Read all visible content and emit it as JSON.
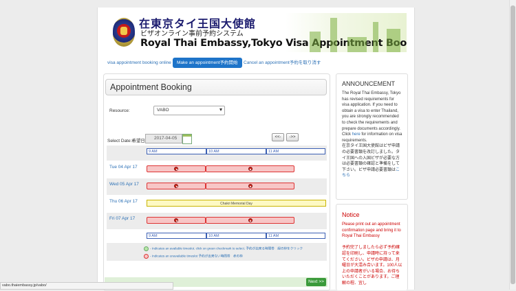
{
  "banner": {
    "line1": "在東京タイ王国大使館",
    "line2": "ビザオンライン事前予約システム",
    "line3": "Royal Thai Embassy,Tokyo Visa Appointment Booking Online"
  },
  "nav": {
    "items": [
      {
        "label": "visa appointment booking online",
        "active": false
      },
      {
        "label": "Make an appointment予約開始",
        "active": true
      },
      {
        "label": "Cancel an appointment予約を取り消す",
        "active": false
      }
    ]
  },
  "booking": {
    "title": "Appointment Booking",
    "resource_label": "Resource:",
    "resource_value": "VABO",
    "date_label": "Select Date:希望日",
    "date_value": "2017-04-05",
    "prev_label": "<<-",
    "next_label": "->>",
    "hours": [
      "9 AM",
      "10 AM",
      "11 AM"
    ],
    "days": [
      {
        "label": "Tue 04 Apr 17",
        "status": "unavailable"
      },
      {
        "label": "Wed 05 Apr 17",
        "status": "unavailable"
      },
      {
        "label": "Thu 06 Apr 17",
        "status": "holiday",
        "note": "Chakri Memorial Day"
      },
      {
        "label": "Fri 07 Apr 17",
        "status": "unavailable"
      }
    ],
    "legend_available": "- Indicates an available timeslot. click on green checkmark to select. 予約が出来る時間帯　緑の枠をクリック",
    "legend_unavailable": "- Indicates an unavailable timeslot 予約が出来ない時間帯　赤の枠",
    "next_button": "Next >>"
  },
  "announcement": {
    "title": "ANNOUNCEMENT",
    "text_before_link": "The Royal Thai Embassy, Tokyo has revised requirements for visa application. If you need to obtain a visa to enter Thailand, you are strongly recommended to check the requirements and prepare documents accordingly. Click",
    "link1": "here",
    "text_after_link": "for information on visa requirements.",
    "jp_text": "在京タイ王国大使館はビザ申請の必要書類を改訂しました。タイ王国への入国ビザが必要な方は必要書類の確認と準備をして下さい。ビザ申請必要書類は",
    "jp_link": "こちら"
  },
  "notice": {
    "title": "Notice",
    "text_en": "Please print out an appointment confirmation page and bring it to Royal Thai Embassy",
    "text_jp": "予約完了しましたら必ず予約確認を印刷し、申請時に持って来てください。ビザの申請は、月曜日が大混み合います。100人以上の申請者がいる場合、お待ちいただくことがあります。ご理解の程、宜し"
  },
  "status_bar": "vabo.thaiembassy.jp/vabo/",
  "colors": {
    "accent": "#1e74c9",
    "unavailable": "#f7c6c6",
    "holiday": "#fdf9c4",
    "next": "#3a9a3a"
  }
}
